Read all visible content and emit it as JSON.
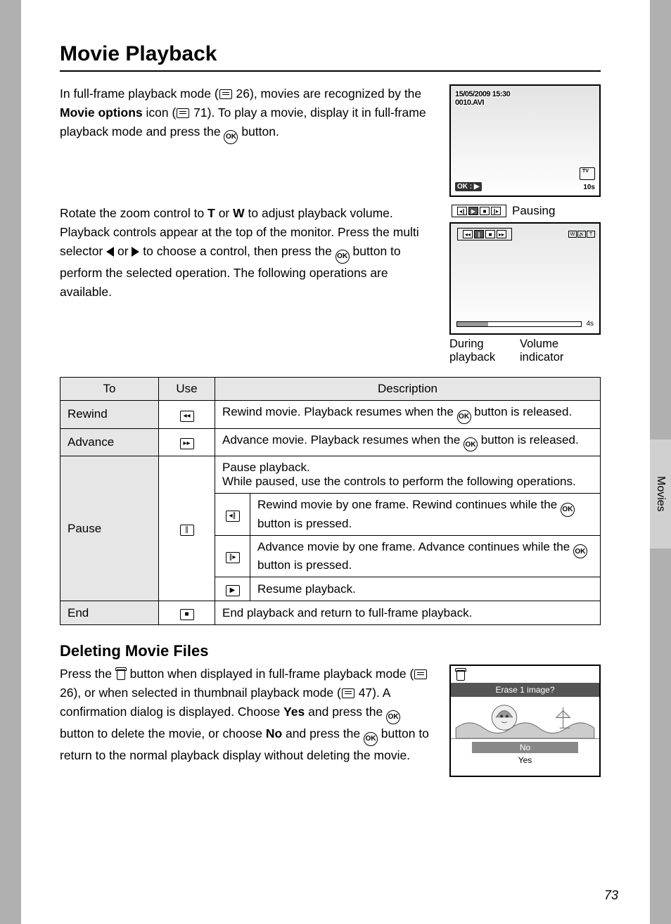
{
  "sidebar_label": "Movies",
  "title": "Movie Playback",
  "intro": {
    "p1_a": "In full-frame playback mode (",
    "p1_ref1": "26",
    "p1_b": "), movies are recognized by the ",
    "p1_bold": "Movie options",
    "p1_c": " icon (",
    "p1_ref2": "71",
    "p1_d": "). To play a movie, display it in full-frame playback mode and press the ",
    "p1_e": " button."
  },
  "screen1": {
    "datetime": "15/05/2009 15:30",
    "filename": "0010.AVI",
    "ok_play": "OK : ▶",
    "in": "IN",
    "time": "10s"
  },
  "middle": {
    "p1_a": "Rotate the zoom control to ",
    "p1_t": "T",
    "p1_b": " or ",
    "p1_w": "W",
    "p1_c": " to adjust playback volume.",
    "p2_a": "Playback controls appear at the top of the monitor. Press the multi selector ",
    "p2_b": " or ",
    "p2_c": " to choose a control, then press the ",
    "p2_d": " button to perform the selected operation. The following operations are available."
  },
  "pausing_label": "Pausing",
  "screen2": {
    "time_remaining": "4s",
    "vol_w": "W",
    "vol_t": "T"
  },
  "fig_labels": {
    "left": "During playback",
    "right": "Volume indicator"
  },
  "table": {
    "h1": "To",
    "h2": "Use",
    "h3": "Description",
    "rewind": "Rewind",
    "rewind_desc_a": "Rewind movie. Playback resumes when the ",
    "rewind_desc_b": " button is released.",
    "advance": "Advance",
    "advance_desc_a": "Advance movie. Playback resumes when the ",
    "advance_desc_b": " button is released.",
    "pause": "Pause",
    "pause_desc": "Pause playback.\nWhile paused, use the controls to perform the following operations.",
    "pause_rw_a": "Rewind movie by one frame. Rewind continues while the ",
    "pause_rw_b": " button is pressed.",
    "pause_fw_a": "Advance movie by one frame. Advance continues while the ",
    "pause_fw_b": " button is pressed.",
    "pause_resume": "Resume playback.",
    "end": "End",
    "end_desc": "End playback and return to full-frame playback."
  },
  "delete": {
    "heading": "Deleting Movie Files",
    "a": "Press the ",
    "b": " button when displayed in full-frame playback mode (",
    "ref1": "26",
    "c": "), or when selected in thumbnail playback mode (",
    "ref2": "47",
    "d": "). A confirmation dialog is displayed. Choose ",
    "yes": "Yes",
    "e": " and press the ",
    "f": " button to delete the movie, or choose ",
    "no": "No",
    "g": " and press the ",
    "h": " button to return to the normal playback display without deleting the movie."
  },
  "screen3": {
    "question": "Erase 1 image?",
    "opt_no": "No",
    "opt_yes": "Yes"
  },
  "page_number": "73",
  "ok_label": "OK"
}
